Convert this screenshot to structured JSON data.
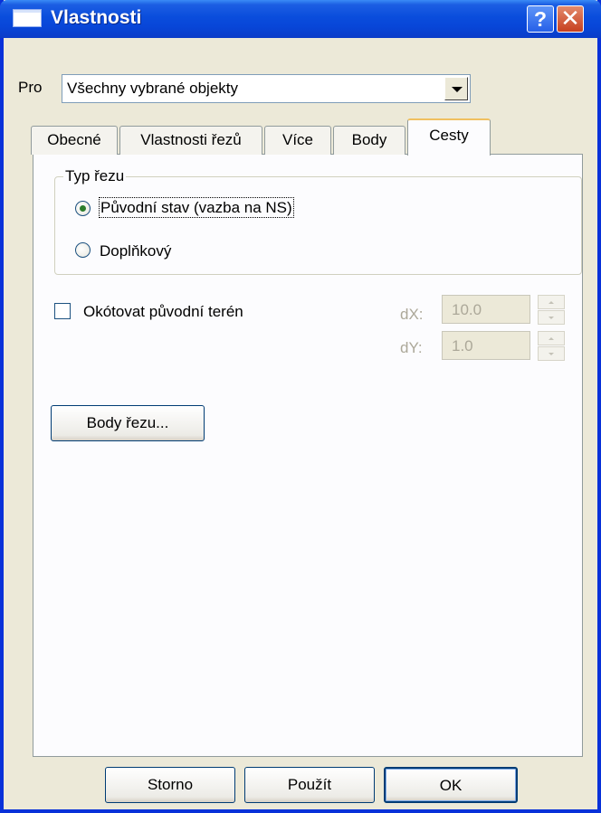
{
  "window": {
    "title": "Vlastnosti"
  },
  "titlebar": {
    "help_glyph": "?",
    "close_glyph": "✕"
  },
  "scope": {
    "label": "Pro",
    "value": "Všechny vybrané objekty"
  },
  "tabs": [
    {
      "label": "Obecné",
      "active": false
    },
    {
      "label": "Vlastnosti řezů",
      "active": false
    },
    {
      "label": "Více",
      "active": false
    },
    {
      "label": "Body",
      "active": false
    },
    {
      "label": "Cesty",
      "active": true
    }
  ],
  "section_type": {
    "title": "Typ řezu",
    "options": [
      {
        "label": "Původní stav (vazba na NS)",
        "selected": true
      },
      {
        "label": "Doplňkový",
        "selected": false
      }
    ]
  },
  "dimension": {
    "checkbox_label": "Okótovat původní terén",
    "checked": false,
    "dx": {
      "label": "dX:",
      "value": "10.0"
    },
    "dy": {
      "label": "dY:",
      "value": "1.0"
    }
  },
  "actions": {
    "section_points_label": "Body řezu..."
  },
  "footer": {
    "cancel_label": "Storno",
    "apply_label": "Použít",
    "ok_label": "OK"
  },
  "colors": {
    "titlebar": "#0a4ddc",
    "window_frame": "#0831d9",
    "panel": "#ece9d8",
    "tab_highlight": "#f0c060"
  }
}
